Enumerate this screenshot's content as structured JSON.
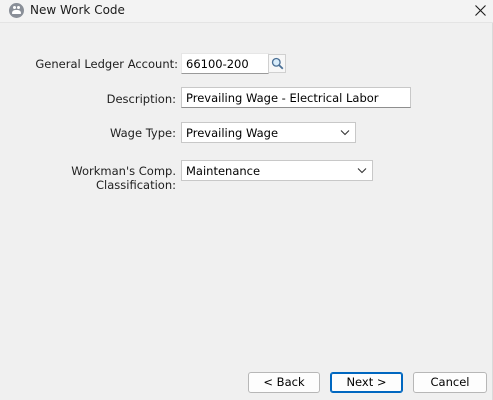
{
  "window": {
    "title": "New Work Code",
    "icon": "app-people-icon",
    "close_icon": "close-icon"
  },
  "form": {
    "gl_account": {
      "label": "General Ledger Account:",
      "value": "66100-200",
      "lookup_icon": "magnifier-icon"
    },
    "description": {
      "label": "Description:",
      "value": "Prevailing Wage - Electrical Labor"
    },
    "wage_type": {
      "label": "Wage Type:",
      "selected": "Prevailing Wage"
    },
    "workmans_comp": {
      "label": "Workman's Comp. Classification:",
      "selected": "Maintenance"
    }
  },
  "buttons": {
    "back": "< Back",
    "next": "Next >",
    "cancel": "Cancel"
  }
}
